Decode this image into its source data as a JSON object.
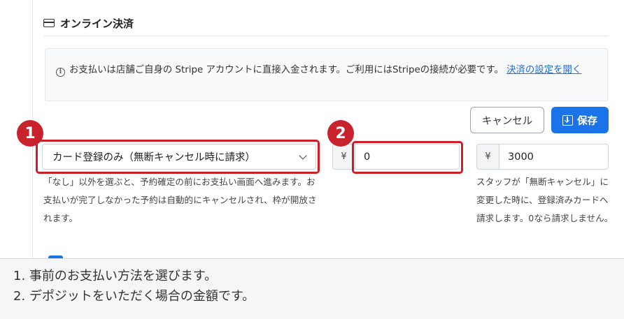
{
  "section": {
    "icon": "credit-card-icon",
    "title": "オンライン決済"
  },
  "info": {
    "icon": "info-icon",
    "text": "お支払いは店舗ご自身の Stripe アカウントに直接入金されます。ご利用にはStripeの接続が必要です。",
    "link": "決済の設定を開く"
  },
  "actions": {
    "cancel_label": "キャンセル",
    "save_label": "保存",
    "save_icon": "save-download-icon"
  },
  "payment_method": {
    "selected": "カード登録のみ（無断キャンセル時に請求）",
    "help": "「なし」以外を選ぶと、予約確定の前にお支払い画面へ進みます。お支払いが完了しなかった予約は自動的にキャンセルされ、枠が開放されます。"
  },
  "deposit": {
    "currency": "¥",
    "value": "0"
  },
  "no_show_fee": {
    "currency": "¥",
    "value": "3000",
    "help": "スタッフが「無断キャンセル」に変更した時に、登録済みカードへ請求します。0なら請求しません。"
  },
  "markers": [
    "1",
    "2"
  ],
  "highlight_color": "#cc1f2a",
  "accent_color": "#1a73e8",
  "caption": {
    "line1": "1. 事前のお支払い方法を選びます。",
    "line2": "2. デポジットをいただく場合の金額です。"
  }
}
